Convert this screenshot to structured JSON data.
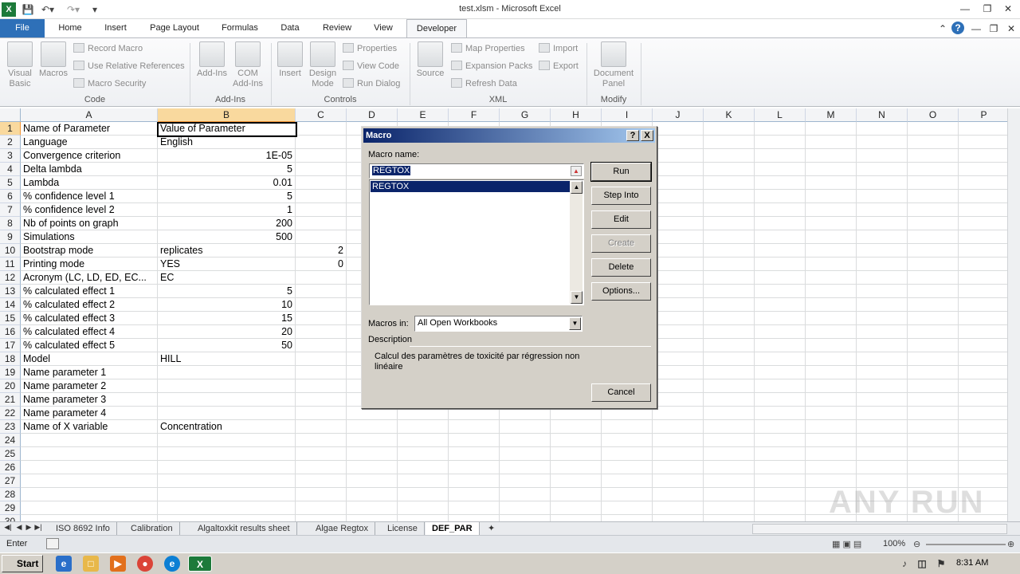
{
  "window": {
    "title": "test.xlsm - Microsoft Excel"
  },
  "qat": {
    "app_icon": "excel-icon",
    "save_icon": "save-icon",
    "undo_icon": "undo-icon",
    "redo_icon": "redo-icon"
  },
  "tabs": [
    {
      "label": "File"
    },
    {
      "label": "Home"
    },
    {
      "label": "Insert"
    },
    {
      "label": "Page Layout"
    },
    {
      "label": "Formulas"
    },
    {
      "label": "Data"
    },
    {
      "label": "Review"
    },
    {
      "label": "View"
    },
    {
      "label": "Developer"
    }
  ],
  "ribbon": {
    "code": {
      "label": "Code",
      "visual_basic": "Visual Basic",
      "macros": "Macros",
      "record_macro": "Record Macro",
      "relative_refs": "Use Relative References",
      "macro_security": "Macro Security"
    },
    "addins": {
      "label": "Add-Ins",
      "addins_btn": "Add-Ins",
      "com_addins": "COM Add-Ins"
    },
    "controls": {
      "label": "Controls",
      "insert": "Insert",
      "design_mode": "Design Mode",
      "properties": "Properties",
      "view_code": "View Code",
      "run_dialog": "Run Dialog"
    },
    "xml": {
      "label": "XML",
      "source": "Source",
      "map_properties": "Map Properties",
      "expansion_packs": "Expansion Packs",
      "refresh_data": "Refresh Data",
      "import": "Import",
      "export": "Export"
    },
    "modify": {
      "label": "Modify",
      "document_panel": "Document Panel"
    }
  },
  "grid": {
    "columns": [
      "A",
      "B",
      "C",
      "D",
      "E",
      "F",
      "G",
      "H",
      "I",
      "J",
      "K",
      "L",
      "M",
      "N",
      "O",
      "P"
    ],
    "rows": [
      {
        "n": "1",
        "a": "Name of Parameter",
        "b": "Value of Parameter",
        "b_num": false,
        "c": ""
      },
      {
        "n": "2",
        "a": "Language",
        "b": "English",
        "b_num": false,
        "c": ""
      },
      {
        "n": "3",
        "a": "Convergence criterion",
        "b": "1E-05",
        "b_num": true,
        "c": ""
      },
      {
        "n": "4",
        "a": "Delta lambda",
        "b": "5",
        "b_num": true,
        "c": ""
      },
      {
        "n": "5",
        "a": "Lambda",
        "b": "0.01",
        "b_num": true,
        "c": ""
      },
      {
        "n": "6",
        "a": "% confidence level 1",
        "b": "5",
        "b_num": true,
        "c": ""
      },
      {
        "n": "7",
        "a": "% confidence level 2",
        "b": "1",
        "b_num": true,
        "c": ""
      },
      {
        "n": "8",
        "a": "Nb of points on graph",
        "b": "200",
        "b_num": true,
        "c": ""
      },
      {
        "n": "9",
        "a": "Simulations",
        "b": "500",
        "b_num": true,
        "c": ""
      },
      {
        "n": "10",
        "a": "Bootstrap mode",
        "b": "replicates",
        "b_num": false,
        "c": "2"
      },
      {
        "n": "11",
        "a": "Printing mode",
        "b": "YES",
        "b_num": false,
        "c": "0"
      },
      {
        "n": "12",
        "a": "Acronym (LC, LD, ED, EC...",
        "b": "EC",
        "b_num": false,
        "c": ""
      },
      {
        "n": "13",
        "a": "% calculated effect 1",
        "b": "5",
        "b_num": true,
        "c": ""
      },
      {
        "n": "14",
        "a": "% calculated effect 2",
        "b": "10",
        "b_num": true,
        "c": ""
      },
      {
        "n": "15",
        "a": "% calculated effect 3",
        "b": "15",
        "b_num": true,
        "c": ""
      },
      {
        "n": "16",
        "a": "% calculated effect 4",
        "b": "20",
        "b_num": true,
        "c": ""
      },
      {
        "n": "17",
        "a": "% calculated effect 5",
        "b": "50",
        "b_num": true,
        "c": ""
      },
      {
        "n": "18",
        "a": "Model",
        "b": "HILL",
        "b_num": false,
        "c": ""
      },
      {
        "n": "19",
        "a": "Name parameter 1",
        "b": "",
        "b_num": false,
        "c": ""
      },
      {
        "n": "20",
        "a": "Name parameter 2",
        "b": "",
        "b_num": false,
        "c": ""
      },
      {
        "n": "21",
        "a": "Name parameter 3",
        "b": "",
        "b_num": false,
        "c": ""
      },
      {
        "n": "22",
        "a": "Name parameter 4",
        "b": "",
        "b_num": false,
        "c": ""
      },
      {
        "n": "23",
        "a": "Name of X variable",
        "b": "Concentration",
        "b_num": false,
        "c": ""
      },
      {
        "n": "24",
        "a": "",
        "b": "",
        "b_num": false,
        "c": ""
      },
      {
        "n": "25",
        "a": "",
        "b": "",
        "b_num": false,
        "c": ""
      },
      {
        "n": "26",
        "a": "",
        "b": "",
        "b_num": false,
        "c": ""
      },
      {
        "n": "27",
        "a": "",
        "b": "",
        "b_num": false,
        "c": ""
      },
      {
        "n": "28",
        "a": "",
        "b": "",
        "b_num": false,
        "c": ""
      },
      {
        "n": "29",
        "a": "",
        "b": "",
        "b_num": false,
        "c": ""
      },
      {
        "n": "30",
        "a": "",
        "b": "",
        "b_num": false,
        "c": ""
      }
    ],
    "selected_column": "B",
    "selected_row": "1"
  },
  "sheets": [
    "ISO 8692 Info",
    "Calibration",
    "Algaltoxkit results sheet",
    "Algae Regtox",
    "License",
    "DEF_PAR"
  ],
  "active_sheet": "DEF_PAR",
  "status": {
    "mode": "Enter",
    "zoom": "100%"
  },
  "dialog": {
    "title": "Macro",
    "help_btn": "?",
    "close_btn": "X",
    "macro_name_label": "Macro name:",
    "macro_name_value": "REGTOX",
    "macros": [
      "REGTOX"
    ],
    "macros_in_label": "Macros in:",
    "macros_in_value": "All Open Workbooks",
    "description_label": "Description",
    "description_text": "Calcul des paramètres de toxicité par régression non linéaire",
    "buttons": {
      "run": "Run",
      "step_into": "Step Into",
      "edit": "Edit",
      "create": "Create",
      "delete": "Delete",
      "options": "Options...",
      "cancel": "Cancel"
    }
  },
  "taskbar": {
    "start": "Start",
    "clock": "8:31 AM"
  },
  "watermark": "ANY RUN"
}
